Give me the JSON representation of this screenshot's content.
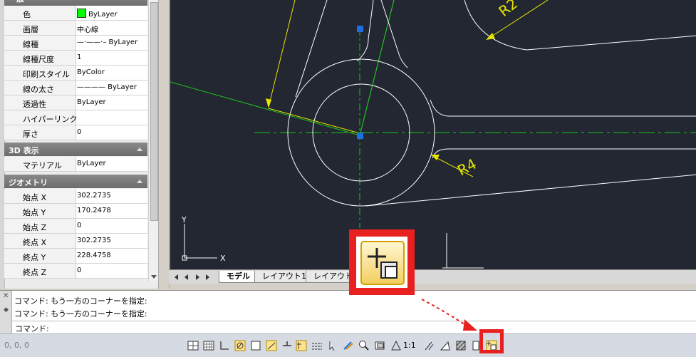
{
  "properties": {
    "general_rows": [
      {
        "label": "色",
        "value": "ByLayer",
        "swatch": "#00ff00"
      },
      {
        "label": "画層",
        "value": "中心線"
      },
      {
        "label": "線種",
        "value": "—·——·– ByLayer"
      },
      {
        "label": "線種尺度",
        "value": "1"
      },
      {
        "label": "印刷スタイル",
        "value": "ByColor"
      },
      {
        "label": "線の太さ",
        "value": "———— ByLayer"
      },
      {
        "label": "透過性",
        "value": "ByLayer"
      },
      {
        "label": "ハイパーリンク",
        "value": ""
      },
      {
        "label": "厚さ",
        "value": "0"
      }
    ],
    "section_3d": {
      "title": "3D 表示",
      "rows": [
        {
          "label": "マテリアル",
          "value": "ByLayer"
        }
      ]
    },
    "section_geometry": {
      "title": "ジオメトリ",
      "rows": [
        {
          "label": "始点 X",
          "value": "302.2735"
        },
        {
          "label": "始点 Y",
          "value": "170.2478"
        },
        {
          "label": "始点 Z",
          "value": "0"
        },
        {
          "label": "終点 X",
          "value": "302.2735"
        },
        {
          "label": "終点 Y",
          "value": "228.4758"
        },
        {
          "label": "終点 Z",
          "value": "0"
        }
      ]
    }
  },
  "drawing": {
    "dim_r4": "R4",
    "dim_r2": "R2",
    "ucs_y": "Y",
    "ucs_x": "X",
    "colors": {
      "background": "#222731",
      "geometry": "#ffffff",
      "centerline": "#1fc41f",
      "dimension": "#e5e500",
      "grip": "#1e6fe0"
    }
  },
  "tabs": [
    {
      "label": "モデル",
      "active": true
    },
    {
      "label": "レイアウト1",
      "active": false
    },
    {
      "label": "レイアウト2",
      "active": false
    }
  ],
  "command": {
    "history": [
      "コマンド:  もう一方のコーナーを指定:",
      "コマンド:  もう一方のコーナーを指定:"
    ],
    "prompt": "コマンド:"
  },
  "status": {
    "coordinates": "0, 0, 0",
    "annotation_scale": "1:1"
  },
  "callout": {
    "icon": "quick-properties-icon",
    "accent": "#e8201f"
  }
}
